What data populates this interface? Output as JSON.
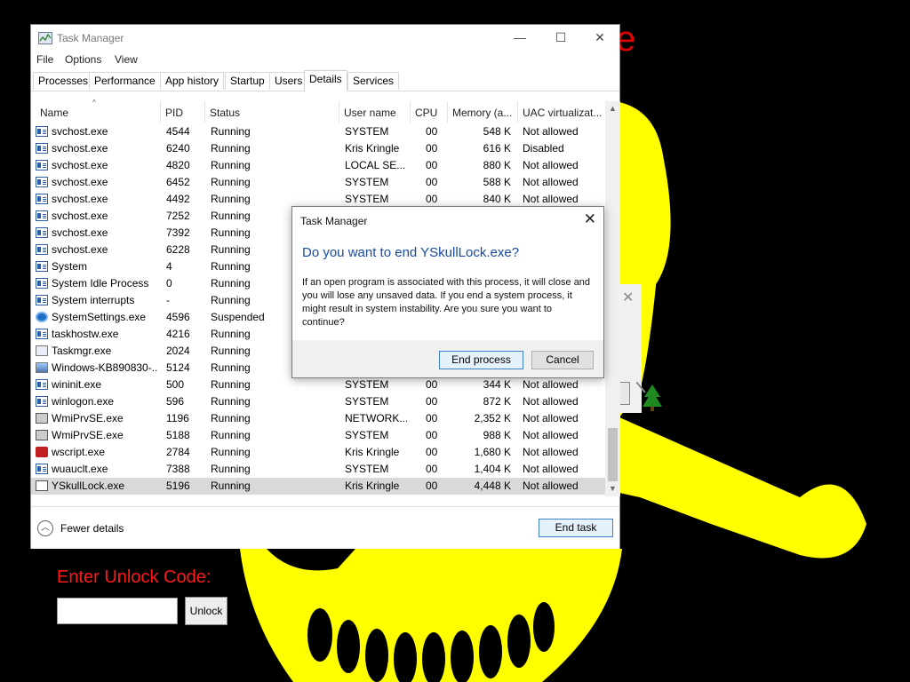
{
  "background": {
    "title_fragment": "",
    "title_tail": "e",
    "unlock_label": "Enter Unlock Code:",
    "unlock_button": "Unlock"
  },
  "window": {
    "title": "Task Manager",
    "controls": {
      "minimize": "—",
      "maximize": "☐",
      "close": "✕"
    }
  },
  "menu": [
    "File",
    "Options",
    "View"
  ],
  "tabs": [
    {
      "label": "Processes"
    },
    {
      "label": "Performance"
    },
    {
      "label": "App history"
    },
    {
      "label": "Startup"
    },
    {
      "label": "Users"
    },
    {
      "label": "Details",
      "active": true
    },
    {
      "label": "Services"
    }
  ],
  "columns": [
    "Name",
    "PID",
    "Status",
    "User name",
    "CPU",
    "Memory (a...",
    "UAC virtualizat..."
  ],
  "rows": [
    {
      "icon": "service-icon",
      "name": "svchost.exe",
      "pid": "4544",
      "status": "Running",
      "user": "SYSTEM",
      "cpu": "00",
      "memory": "548 K",
      "uac": "Not allowed"
    },
    {
      "icon": "service-icon",
      "name": "svchost.exe",
      "pid": "6240",
      "status": "Running",
      "user": "Kris Kringle",
      "cpu": "00",
      "memory": "616 K",
      "uac": "Disabled"
    },
    {
      "icon": "service-icon",
      "name": "svchost.exe",
      "pid": "4820",
      "status": "Running",
      "user": "LOCAL SE...",
      "cpu": "00",
      "memory": "880 K",
      "uac": "Not allowed"
    },
    {
      "icon": "service-icon",
      "name": "svchost.exe",
      "pid": "6452",
      "status": "Running",
      "user": "SYSTEM",
      "cpu": "00",
      "memory": "588 K",
      "uac": "Not allowed"
    },
    {
      "icon": "service-icon",
      "name": "svchost.exe",
      "pid": "4492",
      "status": "Running",
      "user": "SYSTEM",
      "cpu": "00",
      "memory": "840 K",
      "uac": "Not allowed"
    },
    {
      "icon": "service-icon",
      "name": "svchost.exe",
      "pid": "7252",
      "status": "Running",
      "user": "",
      "cpu": "",
      "memory": "",
      "uac": ""
    },
    {
      "icon": "service-icon",
      "name": "svchost.exe",
      "pid": "7392",
      "status": "Running",
      "user": "",
      "cpu": "",
      "memory": "",
      "uac": ""
    },
    {
      "icon": "service-icon",
      "name": "svchost.exe",
      "pid": "6228",
      "status": "Running",
      "user": "",
      "cpu": "",
      "memory": "",
      "uac": ""
    },
    {
      "icon": "service-icon",
      "name": "System",
      "pid": "4",
      "status": "Running",
      "user": "",
      "cpu": "",
      "memory": "",
      "uac": ""
    },
    {
      "icon": "service-icon",
      "name": "System Idle Process",
      "pid": "0",
      "status": "Running",
      "user": "",
      "cpu": "",
      "memory": "",
      "uac": ""
    },
    {
      "icon": "service-icon",
      "name": "System interrupts",
      "pid": "-",
      "status": "Running",
      "user": "",
      "cpu": "",
      "memory": "",
      "uac": ""
    },
    {
      "icon": "gear-icon",
      "name": "SystemSettings.exe",
      "pid": "4596",
      "status": "Suspended",
      "user": "",
      "cpu": "",
      "memory": "",
      "uac": ""
    },
    {
      "icon": "service-icon",
      "name": "taskhostw.exe",
      "pid": "4216",
      "status": "Running",
      "user": "",
      "cpu": "",
      "memory": "",
      "uac": ""
    },
    {
      "icon": "task-manager-icon",
      "name": "Taskmgr.exe",
      "pid": "2024",
      "status": "Running",
      "user": "",
      "cpu": "",
      "memory": "",
      "uac": ""
    },
    {
      "icon": "installer-icon",
      "name": "Windows-KB890830-...",
      "pid": "5124",
      "status": "Running",
      "user": "",
      "cpu": "",
      "memory": "",
      "uac": ""
    },
    {
      "icon": "service-icon",
      "name": "wininit.exe",
      "pid": "500",
      "status": "Running",
      "user": "SYSTEM",
      "cpu": "00",
      "memory": "344 K",
      "uac": "Not allowed"
    },
    {
      "icon": "service-icon",
      "name": "winlogon.exe",
      "pid": "596",
      "status": "Running",
      "user": "SYSTEM",
      "cpu": "00",
      "memory": "872 K",
      "uac": "Not allowed"
    },
    {
      "icon": "wmi-icon",
      "name": "WmiPrvSE.exe",
      "pid": "1196",
      "status": "Running",
      "user": "NETWORK...",
      "cpu": "00",
      "memory": "2,352 K",
      "uac": "Not allowed"
    },
    {
      "icon": "wmi-icon",
      "name": "WmiPrvSE.exe",
      "pid": "5188",
      "status": "Running",
      "user": "SYSTEM",
      "cpu": "00",
      "memory": "988 K",
      "uac": "Not allowed"
    },
    {
      "icon": "script-icon",
      "name": "wscript.exe",
      "pid": "2784",
      "status": "Running",
      "user": "Kris Kringle",
      "cpu": "00",
      "memory": "1,680 K",
      "uac": "Not allowed"
    },
    {
      "icon": "service-icon",
      "name": "wuauclt.exe",
      "pid": "7388",
      "status": "Running",
      "user": "SYSTEM",
      "cpu": "00",
      "memory": "1,404 K",
      "uac": "Not allowed"
    },
    {
      "icon": "skull-icon",
      "name": "YSkullLock.exe",
      "pid": "5196",
      "status": "Running",
      "user": "Kris Kringle",
      "cpu": "00",
      "memory": "4,448 K",
      "uac": "Not allowed",
      "selected": true
    }
  ],
  "footer": {
    "fewer_details": "Fewer details",
    "end_task": "End task"
  },
  "dialog": {
    "title": "Task Manager",
    "heading": "Do you want to end YSkullLock.exe?",
    "body": "If an open program is associated with this process, it will close and you will lose any unsaved data. If you end a system process, it might result in system instability. Are you sure you want to continue?",
    "confirm": "End process",
    "cancel": "Cancel"
  },
  "colors": {
    "background": "#000000",
    "skull": "#ffff00",
    "unlock_label": "#ff1a1a",
    "dialog_heading": "#1a4aa0",
    "selection": "#d9d9d9"
  }
}
